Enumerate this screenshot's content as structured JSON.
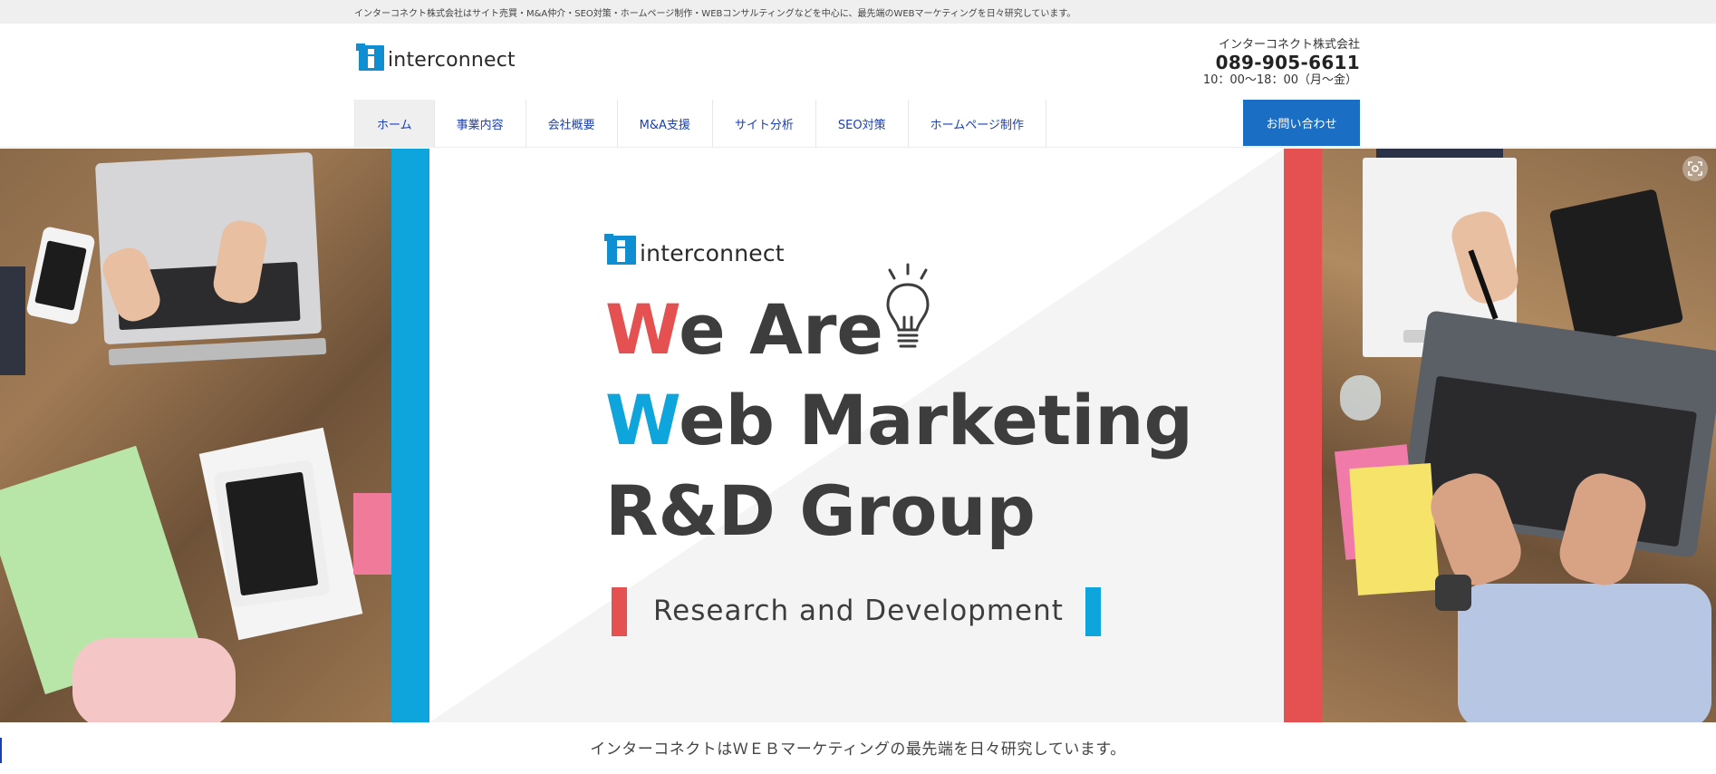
{
  "topbar": {
    "text": "インターコネクト株式会社はサイト売買・M&A仲介・SEO対策・ホームページ制作・WEBコンサルティングなどを中心に、最先端のWEBマーケティングを日々研究しています。"
  },
  "header": {
    "logo_text": "interconnect",
    "company": "インターコネクト株式会社",
    "phone": "089-905-6611",
    "hours": "10：00〜18：00（月〜金）"
  },
  "nav": {
    "items": [
      {
        "label": "ホーム",
        "active": true
      },
      {
        "label": "事業内容"
      },
      {
        "label": "会社概要"
      },
      {
        "label": "M&A支援"
      },
      {
        "label": "サイト分析"
      },
      {
        "label": "SEO対策"
      },
      {
        "label": "ホームページ制作"
      }
    ],
    "cta_label": "お問い合わせ"
  },
  "hero": {
    "logo_text": "interconnect",
    "line1_accent": "W",
    "line1_rest": "e Are",
    "line2_accent": "W",
    "line2_rest": "eb Marketing",
    "line3": "R&D Group",
    "subtitle": "Research and Development",
    "colors": {
      "blue": "#0ea5dd",
      "red": "#e55050",
      "text": "#3d3d3d"
    },
    "icons": [
      "lightbulb-icon",
      "visual-search-icon"
    ]
  },
  "tagline": "インターコネクトはＷＥＢマーケティングの最先端を日々研究しています。"
}
